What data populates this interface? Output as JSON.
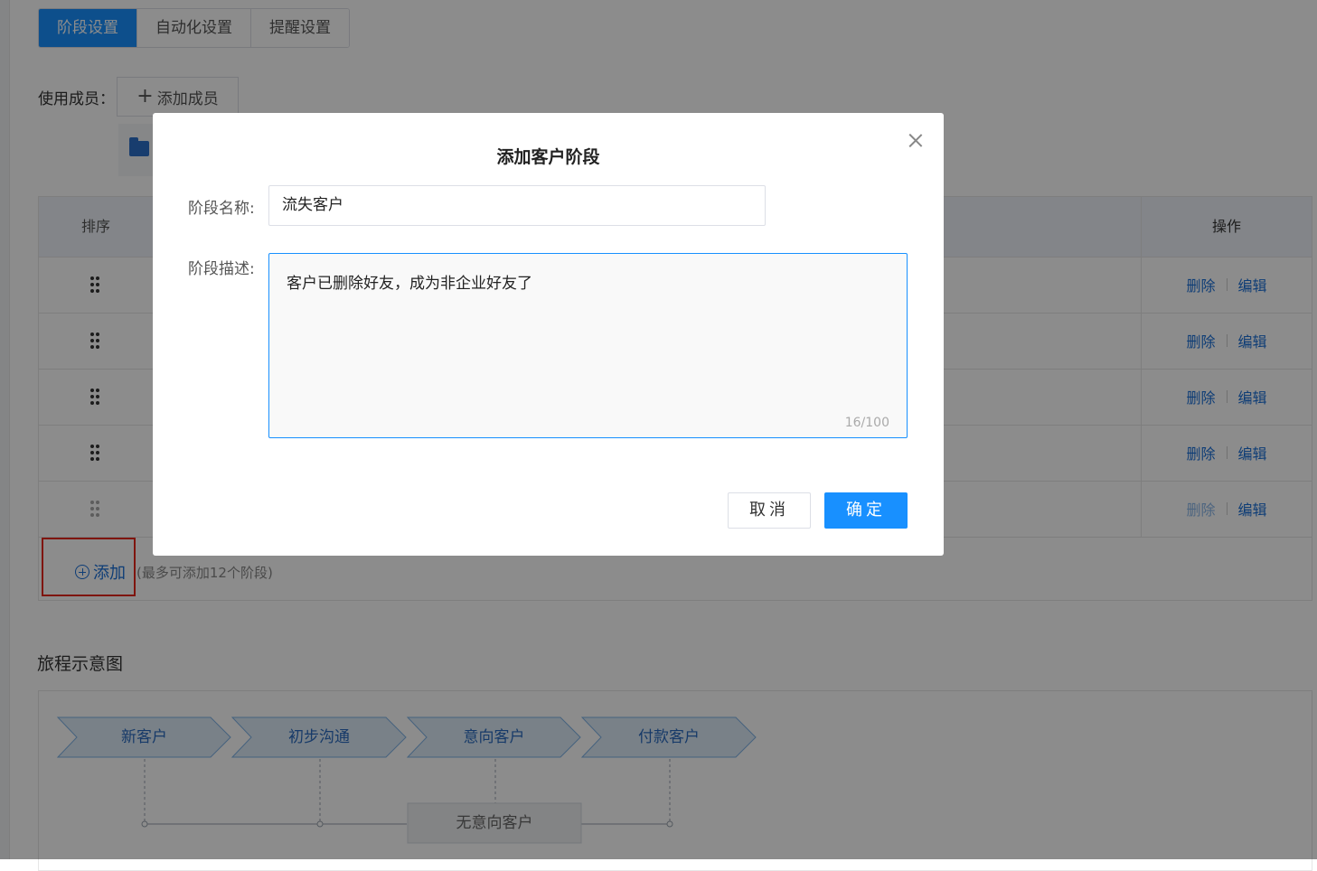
{
  "tabs": [
    {
      "label": "阶段设置",
      "active": true
    },
    {
      "label": "自动化设置",
      "active": false
    },
    {
      "label": "提醒设置",
      "active": false
    }
  ],
  "members": {
    "label": "使用成员：",
    "add_button": "添加成员"
  },
  "table": {
    "headers": {
      "sort": "排序",
      "operation": "操作"
    },
    "rows": [
      {
        "delete": "删除",
        "edit": "编辑",
        "delete_enabled": true
      },
      {
        "delete": "删除",
        "edit": "编辑",
        "delete_enabled": true
      },
      {
        "delete": "删除",
        "edit": "编辑",
        "delete_enabled": true
      },
      {
        "delete": "删除",
        "edit": "编辑",
        "delete_enabled": true
      },
      {
        "delete": "删除",
        "edit": "编辑",
        "delete_enabled": false
      }
    ],
    "add_label": "添加",
    "add_hint": "(最多可添加12个阶段)"
  },
  "journey": {
    "title": "旅程示意图",
    "stages": [
      "新客户",
      "初步沟通",
      "意向客户",
      "付款客户"
    ],
    "lost_stage": "无意向客户"
  },
  "dialog": {
    "title": "添加客户阶段",
    "name_label": "阶段名称:",
    "name_value": "流失客户",
    "desc_label": "阶段描述:",
    "desc_value": "客户已删除好友，成为非企业好友了",
    "counter": "16/100",
    "cancel": "取消",
    "confirm": "确定"
  },
  "colors": {
    "primary": "#1890ff",
    "link": "#1a6fd8",
    "highlight": "#e8271b"
  }
}
